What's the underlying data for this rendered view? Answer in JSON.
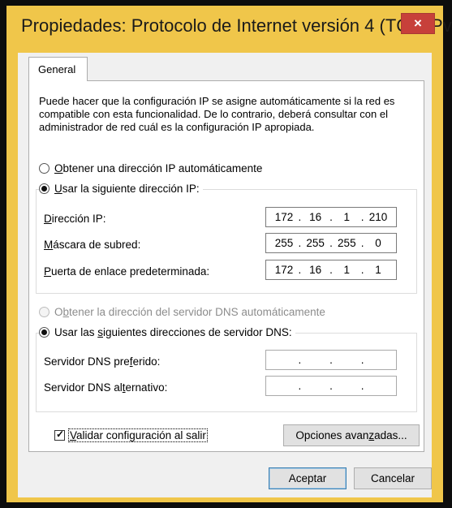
{
  "window": {
    "title": "Propiedades: Protocolo de Internet versión 4 (TCP/IPv...",
    "close_icon": "×",
    "accent_color": "#f0c64a",
    "close_color": "#c7403a"
  },
  "tab": {
    "label": "General"
  },
  "description": "Puede hacer que la configuración IP se asigne automáticamente si la red es compatible con esta funcionalidad. De lo contrario, deberá consultar con el administrador de red cuál es la configuración IP apropiada.",
  "ip": {
    "auto_option": {
      "prefix": "",
      "key": "O",
      "rest": "btener una dirección IP automáticamente",
      "checked": false
    },
    "manual_option": {
      "prefix": "",
      "key": "U",
      "rest": "sar la siguiente dirección IP:",
      "checked": true
    },
    "fields": [
      {
        "prefix": "",
        "key": "D",
        "rest": "irección IP:",
        "octets": [
          "172",
          "16",
          "1",
          "210"
        ]
      },
      {
        "prefix": "",
        "key": "M",
        "rest": "áscara de subred:",
        "octets": [
          "255",
          "255",
          "255",
          "0"
        ]
      },
      {
        "prefix": "",
        "key": "P",
        "rest": "uerta de enlace predeterminada:",
        "octets": [
          "172",
          "16",
          "1",
          "1"
        ]
      }
    ]
  },
  "dns": {
    "auto_option": {
      "prefix": "O",
      "key": "b",
      "rest": "tener la dirección del servidor DNS automáticamente",
      "checked": false,
      "disabled": true
    },
    "manual_option": {
      "prefix": "Usar las ",
      "key": "s",
      "rest": "iguientes direcciones de servidor DNS:",
      "checked": true
    },
    "fields": [
      {
        "prefix": "Servidor DNS pre",
        "key": "f",
        "rest": "erido:",
        "octets": [
          "",
          "",
          "",
          ""
        ]
      },
      {
        "prefix": "Servidor DNS al",
        "key": "t",
        "rest": "ernativo:",
        "octets": [
          "",
          "",
          "",
          ""
        ]
      }
    ]
  },
  "validate": {
    "prefix": "",
    "key": "V",
    "rest": "alidar configuración al salir",
    "checked": true
  },
  "buttons": {
    "advanced": {
      "prefix": "Opciones avan",
      "key": "z",
      "rest": "adas..."
    },
    "ok": "Aceptar",
    "cancel": "Cancelar"
  }
}
